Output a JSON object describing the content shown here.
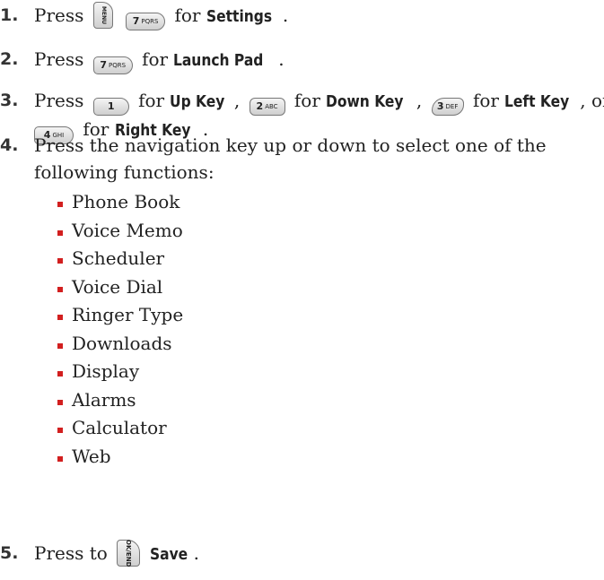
{
  "steps": [
    {
      "number": "1.",
      "press": "Press",
      "key_menu": "MENU",
      "key_7": "7",
      "key_7_sub": "PQRS",
      "for": "for",
      "target": "Settings",
      "period": "."
    },
    {
      "number": "2.",
      "press": "Press",
      "key_7": "7",
      "key_7_sub": "PQRS",
      "for": "for",
      "target": "Launch Pad",
      "period": "."
    },
    {
      "number": "3.",
      "press": "Press",
      "key_1": "1",
      "for_1": "for",
      "target_1": "Up Key",
      "comma_1": ",",
      "key_2": "2",
      "key_2_sub": "ABC",
      "for_2": "for",
      "target_2": "Down Key",
      "comma_2": ",",
      "key_3": "3",
      "key_3_sub": "DEF",
      "for_3": "for",
      "target_3": "Left Key",
      "or": ", or",
      "key_4": "4",
      "key_4_sub": "GHI",
      "for_4": "for",
      "target_4": "Right Key",
      "period": "."
    },
    {
      "number": "4.",
      "line1": "Press the navigation key up or down to select one of the",
      "line2": "following functions:"
    },
    {
      "number": "5.",
      "press_to": "Press to",
      "key_save": "OK/END",
      "target": "Save",
      "period": "."
    }
  ],
  "functions": [
    "Phone Book",
    "Voice Memo",
    "Scheduler",
    "Voice Dial",
    "Ringer Type",
    "Downloads",
    "Display",
    "Alarms",
    "Calculator",
    "Web"
  ],
  "colors": {
    "bullet": "#d21f1f",
    "text": "#222222"
  }
}
